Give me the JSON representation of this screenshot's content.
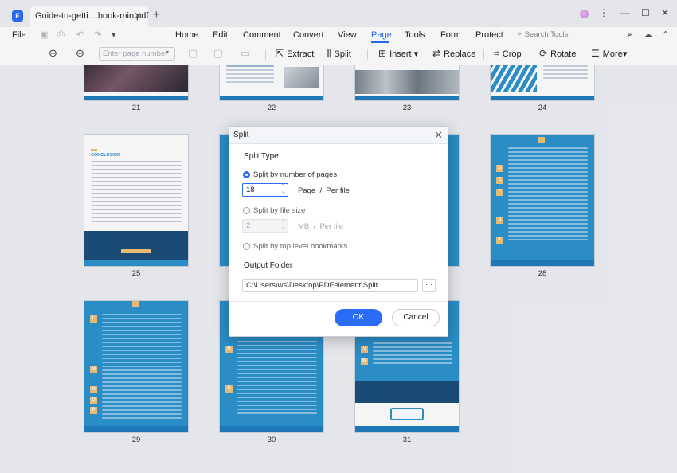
{
  "titlebar": {
    "tab_title": "Guide-to-getti....book-min.pdf",
    "tab_close": "✕",
    "tab_add": "+",
    "win_more": "⋮",
    "win_min": "—",
    "win_max": "☐",
    "win_close": "✕"
  },
  "menu": {
    "file": "File",
    "items": [
      "Home",
      "Edit",
      "Comment",
      "Convert",
      "View",
      "Page",
      "Tools",
      "Form",
      "Protect"
    ],
    "active": "Page",
    "search_tools": "Search Tools"
  },
  "toolbar": {
    "page_number_placeholder": "Enter page number",
    "extract": "Extract",
    "split": "Split",
    "insert": "Insert",
    "replace": "Replace",
    "crop": "Crop",
    "rotate": "Rotate",
    "more": "More"
  },
  "pages": {
    "row1": [
      "21",
      "22",
      "23",
      "24"
    ],
    "row2": [
      "25",
      "28"
    ],
    "row3": [
      "29",
      "30",
      "31"
    ],
    "conclusion_heading": "CONCLUSION"
  },
  "dialog": {
    "title": "Split",
    "close": "✕",
    "split_type_label": "Split Type",
    "options": [
      {
        "label": "Split by number of pages",
        "checked": true
      },
      {
        "label": "Split by file size",
        "checked": false
      },
      {
        "label": "Split by top level bookmarks",
        "checked": false
      }
    ],
    "pages_value": "18",
    "pages_unit": "Page",
    "per_file": "Per file",
    "size_value": "2",
    "size_unit": "MB",
    "size_per_file": "Per file",
    "slash": "/",
    "output_folder_label": "Output Folder",
    "output_path": "C:\\Users\\ws\\Desktop\\PDFelement\\Split",
    "browse": "···",
    "ok": "OK",
    "cancel": "Cancel"
  },
  "colors": {
    "accent": "#2a6cf5",
    "page_blue": "#2d93cf",
    "letter_badge": "#f0c27a"
  }
}
